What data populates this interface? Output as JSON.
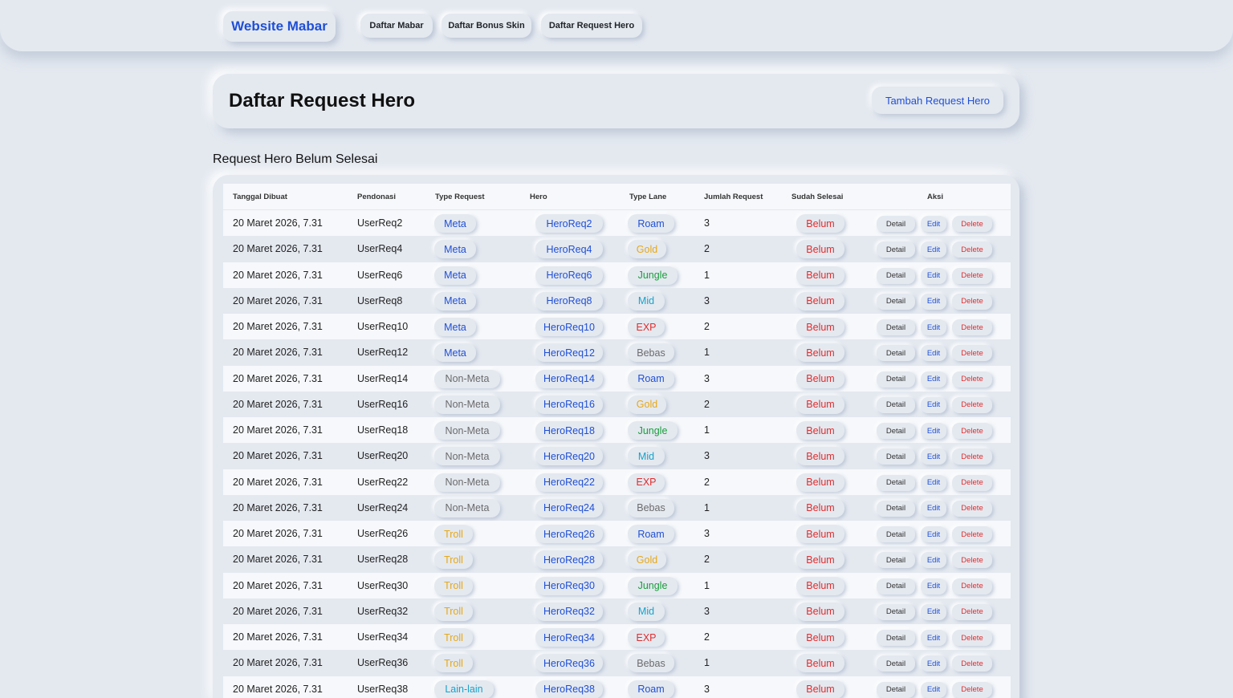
{
  "nav": {
    "brand": "Website Mabar",
    "links": [
      "Daftar Mabar",
      "Daftar Bonus Skin",
      "Daftar Request Hero"
    ]
  },
  "header": {
    "title": "Daftar Request Hero",
    "add_label": "Tambah Request Hero"
  },
  "section_title": "Request Hero Belum Selesai",
  "table": {
    "columns": [
      "Tanggal Dibuat",
      "Pendonasi",
      "Type Request",
      "Hero",
      "Type Lane",
      "Jumlah Request",
      "Sudah Selesai",
      "Aksi"
    ],
    "actions": {
      "detail": "Detail",
      "edit": "Edit",
      "delete": "Delete"
    },
    "rows": [
      {
        "date": "20 Maret 2026, 7.31",
        "donor": "UserReq2",
        "type": "Meta",
        "hero": "HeroReq2",
        "lane": "Roam",
        "count": "3",
        "done": "Belum"
      },
      {
        "date": "20 Maret 2026, 7.31",
        "donor": "UserReq4",
        "type": "Meta",
        "hero": "HeroReq4",
        "lane": "Gold",
        "count": "2",
        "done": "Belum"
      },
      {
        "date": "20 Maret 2026, 7.31",
        "donor": "UserReq6",
        "type": "Meta",
        "hero": "HeroReq6",
        "lane": "Jungle",
        "count": "1",
        "done": "Belum"
      },
      {
        "date": "20 Maret 2026, 7.31",
        "donor": "UserReq8",
        "type": "Meta",
        "hero": "HeroReq8",
        "lane": "Mid",
        "count": "3",
        "done": "Belum"
      },
      {
        "date": "20 Maret 2026, 7.31",
        "donor": "UserReq10",
        "type": "Meta",
        "hero": "HeroReq10",
        "lane": "EXP",
        "count": "2",
        "done": "Belum"
      },
      {
        "date": "20 Maret 2026, 7.31",
        "donor": "UserReq12",
        "type": "Meta",
        "hero": "HeroReq12",
        "lane": "Bebas",
        "count": "1",
        "done": "Belum"
      },
      {
        "date": "20 Maret 2026, 7.31",
        "donor": "UserReq14",
        "type": "Non-Meta",
        "hero": "HeroReq14",
        "lane": "Roam",
        "count": "3",
        "done": "Belum"
      },
      {
        "date": "20 Maret 2026, 7.31",
        "donor": "UserReq16",
        "type": "Non-Meta",
        "hero": "HeroReq16",
        "lane": "Gold",
        "count": "2",
        "done": "Belum"
      },
      {
        "date": "20 Maret 2026, 7.31",
        "donor": "UserReq18",
        "type": "Non-Meta",
        "hero": "HeroReq18",
        "lane": "Jungle",
        "count": "1",
        "done": "Belum"
      },
      {
        "date": "20 Maret 2026, 7.31",
        "donor": "UserReq20",
        "type": "Non-Meta",
        "hero": "HeroReq20",
        "lane": "Mid",
        "count": "3",
        "done": "Belum"
      },
      {
        "date": "20 Maret 2026, 7.31",
        "donor": "UserReq22",
        "type": "Non-Meta",
        "hero": "HeroReq22",
        "lane": "EXP",
        "count": "2",
        "done": "Belum"
      },
      {
        "date": "20 Maret 2026, 7.31",
        "donor": "UserReq24",
        "type": "Non-Meta",
        "hero": "HeroReq24",
        "lane": "Bebas",
        "count": "1",
        "done": "Belum"
      },
      {
        "date": "20 Maret 2026, 7.31",
        "donor": "UserReq26",
        "type": "Troll",
        "hero": "HeroReq26",
        "lane": "Roam",
        "count": "3",
        "done": "Belum"
      },
      {
        "date": "20 Maret 2026, 7.31",
        "donor": "UserReq28",
        "type": "Troll",
        "hero": "HeroReq28",
        "lane": "Gold",
        "count": "2",
        "done": "Belum"
      },
      {
        "date": "20 Maret 2026, 7.31",
        "donor": "UserReq30",
        "type": "Troll",
        "hero": "HeroReq30",
        "lane": "Jungle",
        "count": "1",
        "done": "Belum"
      },
      {
        "date": "20 Maret 2026, 7.31",
        "donor": "UserReq32",
        "type": "Troll",
        "hero": "HeroReq32",
        "lane": "Mid",
        "count": "3",
        "done": "Belum"
      },
      {
        "date": "20 Maret 2026, 7.31",
        "donor": "UserReq34",
        "type": "Troll",
        "hero": "HeroReq34",
        "lane": "EXP",
        "count": "2",
        "done": "Belum"
      },
      {
        "date": "20 Maret 2026, 7.31",
        "donor": "UserReq36",
        "type": "Troll",
        "hero": "HeroReq36",
        "lane": "Bebas",
        "count": "1",
        "done": "Belum"
      },
      {
        "date": "20 Maret 2026, 7.31",
        "donor": "UserReq38",
        "type": "Lain-lain",
        "hero": "HeroReq38",
        "lane": "Roam",
        "count": "3",
        "done": "Belum"
      }
    ]
  },
  "colors": {
    "background": "#e4e9f0",
    "accent": "#1f4fd6",
    "danger": "#e02d2d",
    "type": {
      "Meta": "#1f4fd6",
      "Non-Meta": "#6b6b6b",
      "Troll": "#e6a817",
      "Lain-lain": "#17a2c9"
    },
    "lane": {
      "Roam": "#1f4fd6",
      "Gold": "#e6a817",
      "Jungle": "#1a9e3c",
      "Mid": "#17a2c9",
      "EXP": "#e02d2d",
      "Bebas": "#6b6b6b"
    }
  }
}
